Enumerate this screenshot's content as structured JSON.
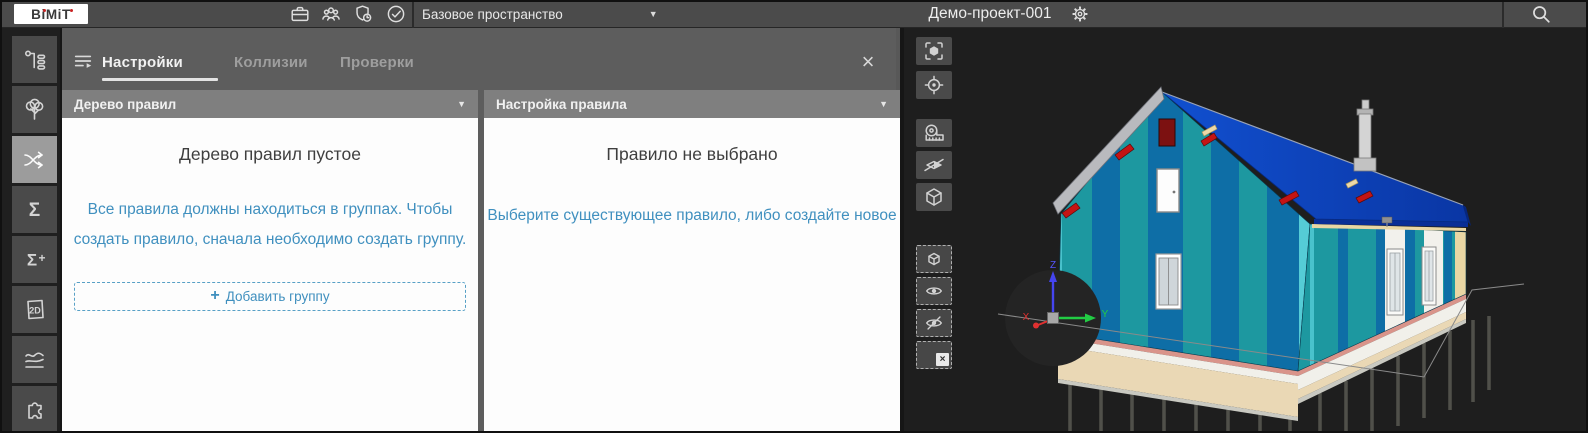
{
  "topbar": {
    "logo_text": "BiMiT",
    "workspace_selector": "Базовое пространство",
    "project_title": "Демо-проект-001"
  },
  "icons": {
    "caret_down": "▼",
    "close": "×",
    "small_close": "×",
    "plus": "+"
  },
  "sidebar": {
    "items": [
      "model-structure",
      "environment-tree",
      "clash-routing",
      "summary",
      "summary-add",
      "sheets-2d",
      "graphs",
      "plugins"
    ],
    "active_item": "clash-routing"
  },
  "panel": {
    "tabs": [
      {
        "label": "Настройки",
        "active": true
      },
      {
        "label": "Коллизии",
        "active": false
      },
      {
        "label": "Проверки",
        "active": false
      }
    ],
    "rules_tree": {
      "header": "Дерево правил",
      "empty_title": "Дерево правил пустое",
      "hint": "Все правила должны находиться в группах. Чтобы создать правило, сначала необходимо создать группу.",
      "add_group_label": "Добавить группу"
    },
    "rule_settings": {
      "header": "Настройка правила",
      "empty_title": "Правило не выбрано",
      "hint": "Выберите существующее правило, либо создайте новое"
    }
  },
  "viewport": {
    "tools": [
      "fit-view",
      "focus-selection",
      "measure",
      "section-plane",
      "section-box",
      "isolate-selection",
      "show-selection",
      "hide-selection",
      "clear-selection"
    ],
    "axis": {
      "x": "X",
      "y": "Y",
      "z": "Z"
    }
  },
  "colors": {
    "accent_blue": "#3f8fbe",
    "topbar_bg": "#4b4b4b",
    "panel_bg": "#5d5d5d",
    "section_header_bg": "#7f7f7f",
    "viewport_bg": "#1e1e1e",
    "roof_blue": "#0d47c8",
    "wall_teal": "#1d98a0",
    "wall_blue": "#0e6ea6",
    "platform_cream": "#ead8b5",
    "highlight_red": "#c41414",
    "axis_x": "#e03030",
    "axis_y": "#22cc44",
    "axis_z": "#4545f0"
  }
}
